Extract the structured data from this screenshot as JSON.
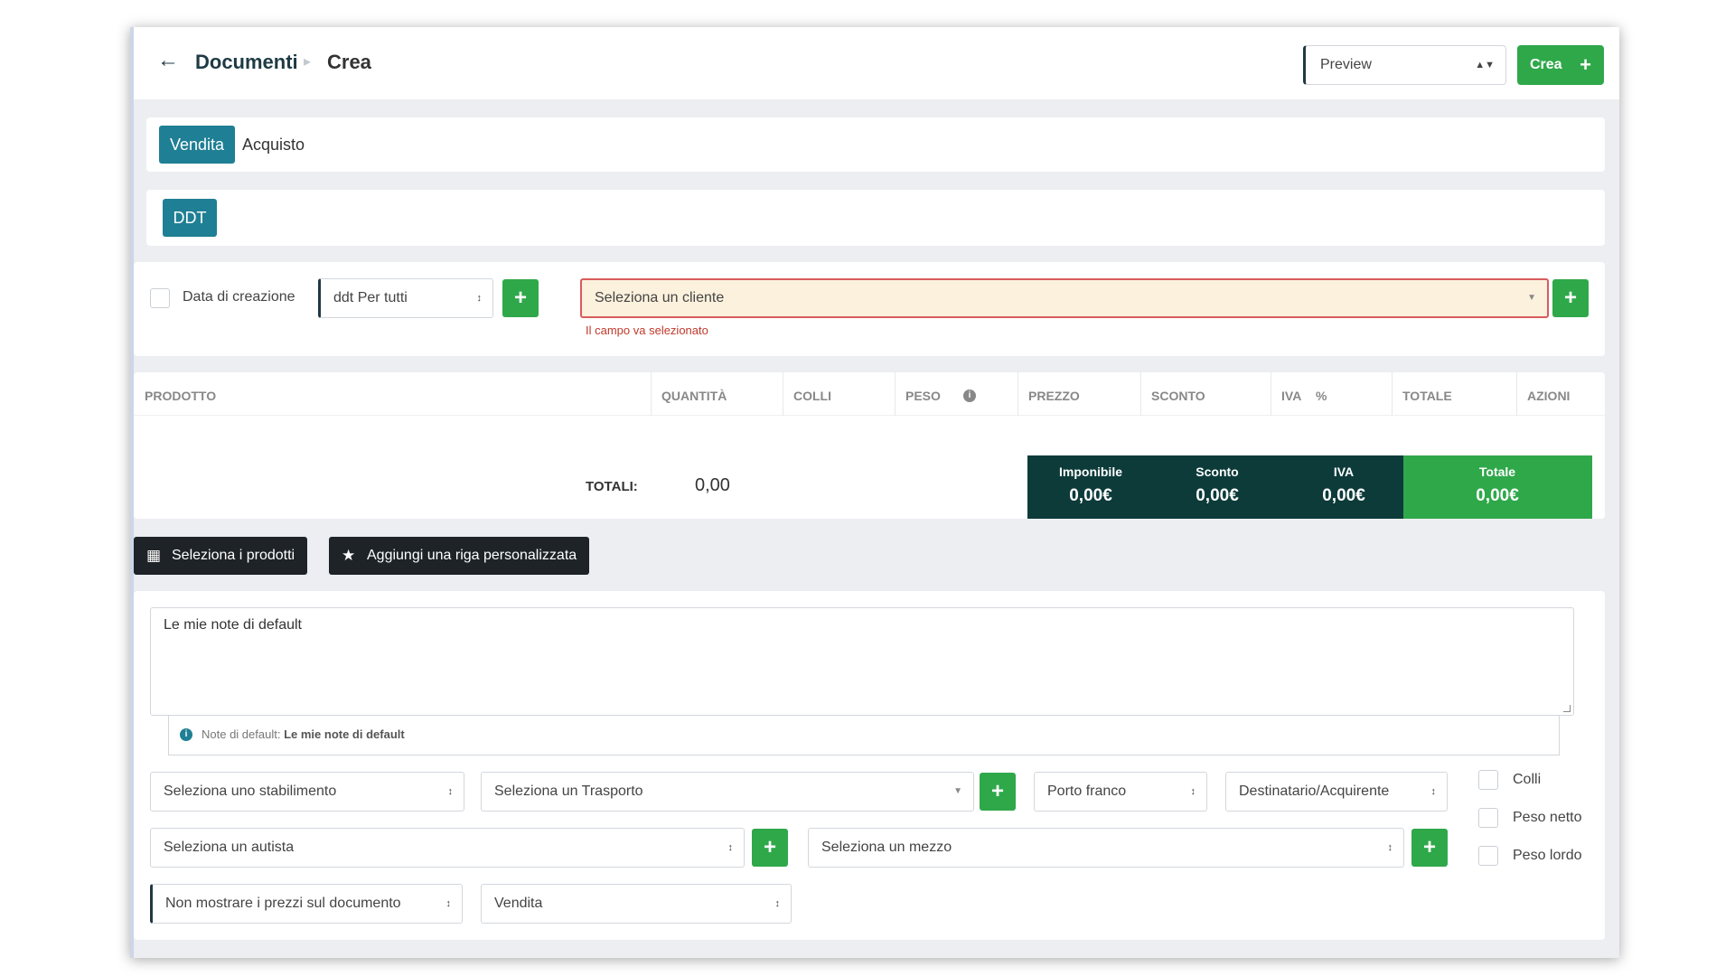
{
  "header": {
    "breadcrumb": [
      "Documenti",
      "Crea"
    ],
    "preview_select": "Preview",
    "create_label": "Crea"
  },
  "tabs": [
    "Vendita",
    "Acquisto"
  ],
  "doc_type": "DDT",
  "form": {
    "date_label": "Data di creazione",
    "series_select": "ddt Per tutti",
    "client_placeholder": "Seleziona un cliente",
    "client_error": "Il campo va selezionato"
  },
  "table": {
    "headers": [
      "PRODOTTO",
      "QUANTITÀ",
      "COLLI",
      "PESO",
      "PREZZO",
      "SCONTO",
      "IVA",
      "TOTALE",
      "AZIONI"
    ],
    "iva_suffix": "%",
    "totals_label": "TOTALI:",
    "totals_value": "0,00"
  },
  "summary": [
    {
      "title": "Imponibile",
      "value": "0,00€"
    },
    {
      "title": "Sconto",
      "value": "0,00€"
    },
    {
      "title": "IVA",
      "value": "0,00€"
    },
    {
      "title": "Totale",
      "value": "0,00€"
    }
  ],
  "actions": {
    "select_products": "Seleziona i prodotti",
    "add_custom_row": "Aggiungi una riga personalizzata"
  },
  "notes": {
    "text": "Le mie note di default",
    "hint_label": "Note di default:",
    "hint_value": "Le mie note di default"
  },
  "shipping": {
    "plant": "Seleziona uno stabilimento",
    "transport": "Seleziona un Trasporto",
    "port": "Porto franco",
    "recipient": "Destinatario/Acquirente",
    "driver": "Seleziona un autista",
    "vehicle": "Seleziona un mezzo",
    "prices": "Non mostrare i prezzi sul documento",
    "reason": "Vendita",
    "checks": [
      "Colli",
      "Peso netto",
      "Peso lordo"
    ]
  },
  "colors": {
    "primary": "#1f7f94",
    "success": "#2fa84a",
    "dark": "#0c3b3a",
    "error": "#c0392b"
  }
}
